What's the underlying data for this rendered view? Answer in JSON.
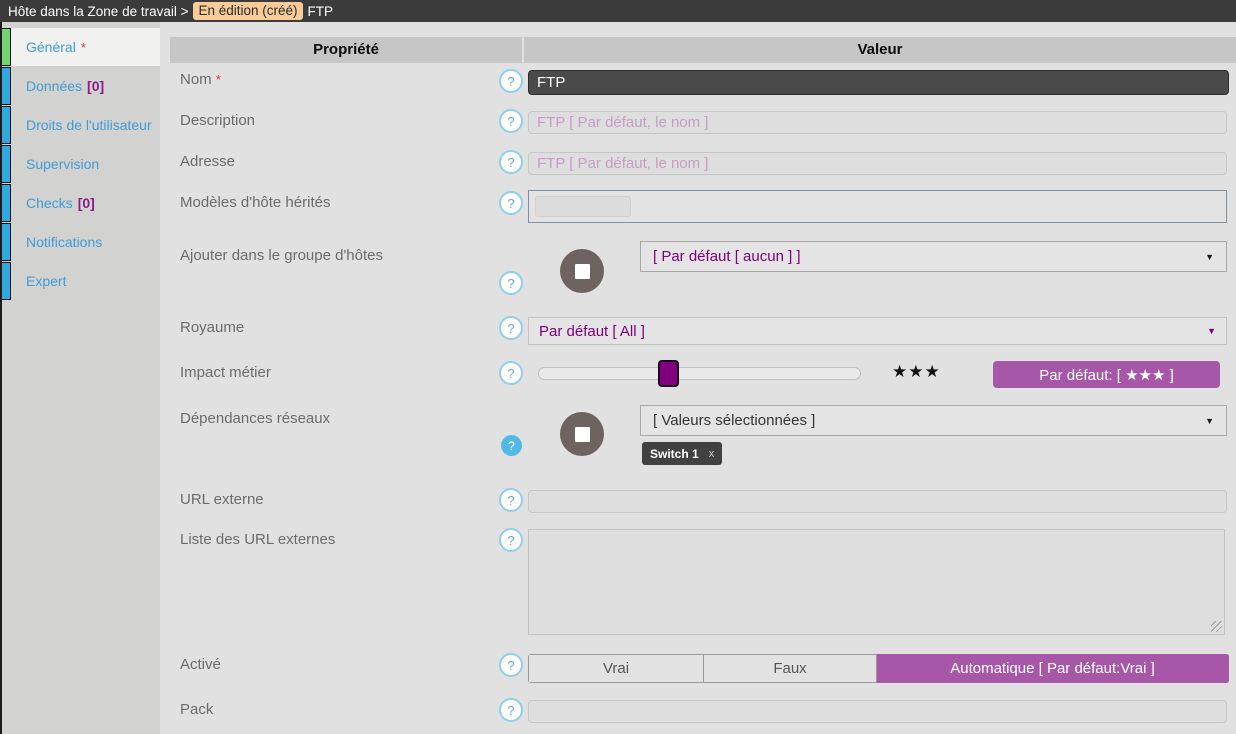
{
  "topbar": {
    "breadcrumb": "Hôte dans la Zone de travail >",
    "state_badge": "En édition (créé)",
    "object_name": "FTP"
  },
  "sidebar": {
    "items": [
      {
        "label": "Général",
        "required": "*",
        "active": true
      },
      {
        "label": "Données",
        "count": "[0]"
      },
      {
        "label": "Droits de l'utilisateur"
      },
      {
        "label": "Supervision"
      },
      {
        "label": "Checks",
        "count": "[0]"
      },
      {
        "label": "Notifications"
      },
      {
        "label": "Expert"
      }
    ]
  },
  "table": {
    "property_header": "Propriété",
    "value_header": "Valeur"
  },
  "rows": {
    "nom": {
      "label": "Nom",
      "required": "*",
      "value": "FTP"
    },
    "description": {
      "label": "Description",
      "placeholder": "FTP [ Par défaut, le nom ]"
    },
    "adresse": {
      "label": "Adresse",
      "placeholder": "FTP [ Par défaut, le nom ]"
    },
    "modeles": {
      "label": "Modèles d'hôte hérités"
    },
    "groupe": {
      "label": "Ajouter dans le groupe d'hôtes",
      "value": "[ Par défaut [ aucun ] ]"
    },
    "royaume": {
      "label": "Royaume",
      "value": "Par défaut [ All ]"
    },
    "impact": {
      "label": "Impact métier",
      "stars": "★★★",
      "default_label": "Par défaut: [ ★★★ ]"
    },
    "dependances": {
      "label": "Dépendances réseaux",
      "value": "[ Valeurs sélectionnées ]",
      "tag": {
        "label": "Switch 1"
      }
    },
    "url": {
      "label": "URL externe"
    },
    "url_list": {
      "label": "Liste des URL externes"
    },
    "active": {
      "label": "Activé",
      "options": [
        "Vrai",
        "Faux",
        "Automatique [ Par défaut:Vrai ]"
      ],
      "selected": 2
    },
    "pack": {
      "label": "Pack"
    }
  },
  "icons": {
    "help": "?",
    "arrow_down": "▼",
    "close": "x"
  },
  "colors": {
    "accent_purple": "#a757a7",
    "value_purple": "#800080",
    "active_bar_green": "#72d472",
    "nav_bar_blue": "#31a8e0",
    "badge_peach": "#f8cb97",
    "dark_input": "#4a4a4a"
  }
}
